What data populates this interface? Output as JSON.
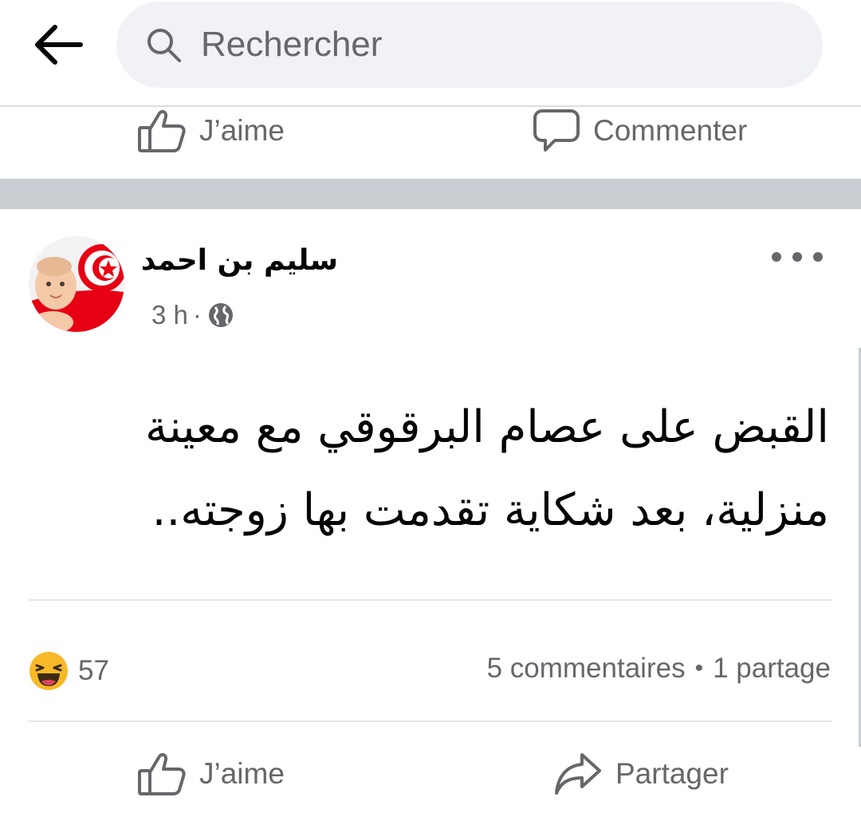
{
  "search": {
    "placeholder": "Rechercher"
  },
  "icons": {
    "back": "arrow-left-icon",
    "search": "search-icon",
    "like": "thumbs-up-icon",
    "comment": "comment-bubble-icon",
    "share": "share-arrow-icon",
    "globe": "globe-icon",
    "more": "more-horizontal-icon",
    "reaction": "haha-emoji-icon"
  },
  "previous_post": {
    "like_label": "J’aime",
    "comment_label": "Commenter"
  },
  "post": {
    "author": "سليم بن احمد",
    "time": "3 h",
    "meta_separator": "·",
    "text": "القبض على عصام البرقوقي مع معينة منزلية، بعد شكاية تقدمت بها زوجته..",
    "reaction_count": "57",
    "comments": "5 commentaires",
    "stats_separator": "•",
    "shares": "1 partage",
    "like_label": "J’aime",
    "share_label": "Partager"
  },
  "colors": {
    "secondary_text": "#65676b",
    "search_bg": "#f0f2f5",
    "separator_band": "#c9ccd1",
    "flag_red": "#e70013"
  }
}
